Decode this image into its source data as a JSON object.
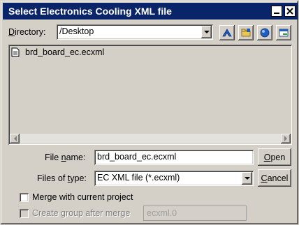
{
  "window": {
    "title": "Select Electronics Cooling XML file",
    "minimize_icon": "minimize-icon",
    "close_icon": "close-icon"
  },
  "directory": {
    "label_prefix": "D",
    "label_rest": "irectory:",
    "value": "/Desktop"
  },
  "toolbar": {
    "icons": [
      "up-folder-icon",
      "new-folder-icon",
      "home-icon",
      "refresh-icon"
    ]
  },
  "file_list": {
    "items": [
      {
        "name": "brd_board_ec.ecxml",
        "icon": "file-icon"
      }
    ]
  },
  "file_name": {
    "label_pre": "File ",
    "label_u": "n",
    "label_post": "ame:",
    "value": "brd_board_ec.ecxml"
  },
  "file_type": {
    "label_pre": "Files of ",
    "label_u": "t",
    "label_post": "ype:",
    "value": "EC XML file (*.ecxml)"
  },
  "buttons": {
    "open_u": "O",
    "open_rest": "pen",
    "cancel_pre": "",
    "cancel_u": "C",
    "cancel_rest": "ancel"
  },
  "options": {
    "merge_label": "Merge with current project",
    "merge_checked": false,
    "group_label": "Create group after merge",
    "group_checked": false,
    "group_name_placeholder": "ecxml.0"
  }
}
